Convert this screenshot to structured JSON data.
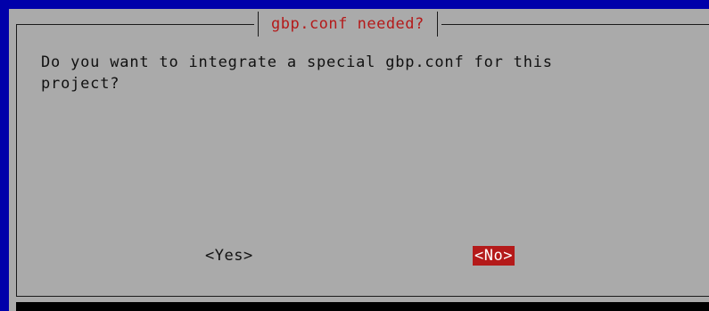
{
  "dialog": {
    "title": "gbp.conf needed?",
    "message": "Do you want to integrate a special gbp.conf for this\nproject?",
    "buttons": {
      "yes_label": "<Yes>",
      "no_label": "<No>"
    },
    "selected_button": "no"
  },
  "colors": {
    "background": "#0000aa",
    "dialog": "#aaaaaa",
    "title": "#b41a1a",
    "selected_button_bg": "#b41a1a",
    "selected_button_fg": "#ffffff"
  }
}
